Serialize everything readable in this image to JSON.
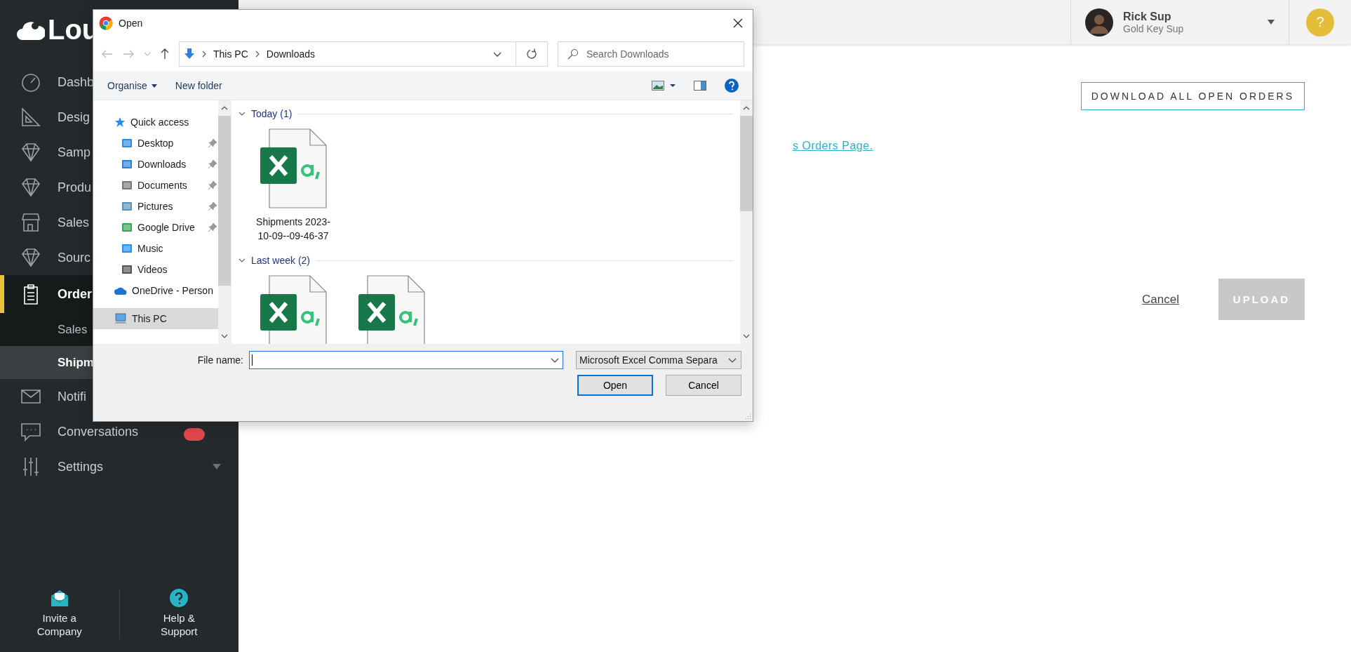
{
  "sidebar": {
    "logo_text": "Lou",
    "items": [
      {
        "label": "Dashb",
        "selected": false,
        "caret": false,
        "badge": false
      },
      {
        "label": "Desig",
        "selected": false,
        "caret": false,
        "badge": false
      },
      {
        "label": "Samp",
        "selected": false,
        "caret": false,
        "badge": false
      },
      {
        "label": "Produ",
        "selected": false,
        "caret": false,
        "badge": false
      },
      {
        "label": "Sales",
        "selected": false,
        "caret": false,
        "badge": false
      },
      {
        "label": "Sourc",
        "selected": false,
        "caret": false,
        "badge": false
      },
      {
        "label": "Order",
        "selected": true,
        "caret": false,
        "badge": false,
        "children": [
          {
            "label": "Sales",
            "selected": false
          },
          {
            "label": "Shipm",
            "selected": true
          }
        ]
      },
      {
        "label": "Notifi",
        "selected": false,
        "caret": false,
        "badge": false
      },
      {
        "label": "Conversations",
        "selected": false,
        "caret": false,
        "badge": true
      },
      {
        "label": "Settings",
        "selected": false,
        "caret": true,
        "badge": false
      }
    ],
    "footer": [
      "Invite a Company",
      "Help & Support"
    ]
  },
  "header": {
    "user": {
      "name": "Rick Sup",
      "role": "Gold Key Sup"
    },
    "help": "?"
  },
  "page": {
    "download_button": "DOWNLOAD ALL OPEN ORDERS",
    "link": "s Orders Page.",
    "cancel": "Cancel",
    "upload": {
      "label": "UPLOAD",
      "disabled": true
    }
  },
  "dialog": {
    "title": "Open",
    "address": [
      "This PC",
      "Downloads"
    ],
    "search": {
      "placeholder": "Search Downloads"
    },
    "commands": [
      "Organise",
      "New folder"
    ],
    "nav": [
      {
        "label": "Quick access",
        "selected": false,
        "children": [
          {
            "label": "Desktop",
            "selected": false,
            "pinned": true
          },
          {
            "label": "Downloads",
            "selected": false,
            "pinned": true
          },
          {
            "label": "Documents",
            "selected": false,
            "pinned": true
          },
          {
            "label": "Pictures",
            "selected": false,
            "pinned": true
          },
          {
            "label": "Google Drive",
            "selected": false,
            "pinned": true
          },
          {
            "label": "Music",
            "selected": false,
            "pinned": false
          },
          {
            "label": "Videos",
            "selected": false,
            "pinned": false
          }
        ]
      },
      {
        "label": "OneDrive - Person",
        "selected": false
      },
      {
        "label": "This PC",
        "selected": true
      }
    ],
    "groups": [
      {
        "label": "Today (1)",
        "files": [
          {
            "kind": "csv",
            "name": "Shipments 2023-10-09--09-46-37"
          }
        ]
      },
      {
        "label": "Last week (2)",
        "files": [
          {
            "kind": "csv"
          },
          {
            "kind": "csv"
          }
        ]
      }
    ],
    "file_name_label": "File name:",
    "file_type": "Microsoft Excel Comma Separa",
    "buttons": [
      {
        "label": "Open",
        "default": true
      },
      {
        "label": "Cancel",
        "default": false
      }
    ]
  }
}
